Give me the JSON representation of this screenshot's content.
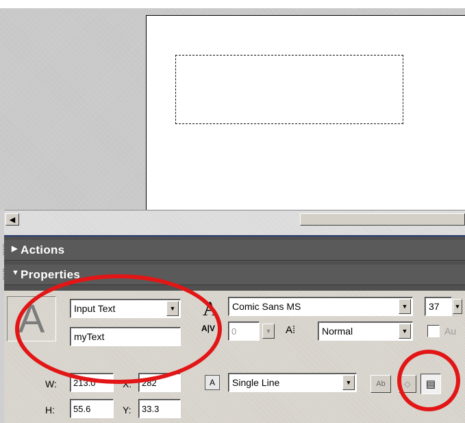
{
  "panels": {
    "actions": {
      "title": "Actions"
    },
    "properties": {
      "title": "Properties"
    }
  },
  "properties": {
    "text_type": "Input Text",
    "instance_name": "myText",
    "font_family": "Comic Sans MS",
    "font_size": "37",
    "char_spacing": "0",
    "char_position": "Normal",
    "auto_kern_label": "Au",
    "line_type": "Single Line",
    "width_label": "W:",
    "width_value": "213.0",
    "x_label": "X:",
    "x_value": "282",
    "height_label": "H:",
    "height_value": "55.6",
    "y_label": "Y:",
    "y_value": "33.3",
    "selectable_label": "Ab"
  },
  "annotation_color": "#e21616"
}
